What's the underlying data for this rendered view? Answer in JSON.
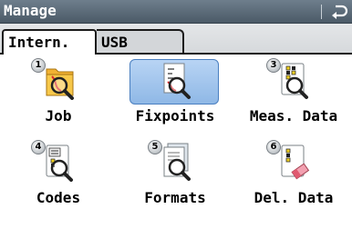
{
  "window": {
    "title": "Manage"
  },
  "tabs": [
    {
      "label": "Intern.",
      "active": true
    },
    {
      "label": "USB",
      "active": false
    }
  ],
  "items": [
    {
      "label": "Job",
      "badge": "1",
      "icon": "folder-search-icon",
      "selected": false
    },
    {
      "label": "Fixpoints",
      "badge": "",
      "icon": "fixpoints-search-icon",
      "selected": true
    },
    {
      "label": "Meas. Data",
      "badge": "3",
      "icon": "measurement-data-search-icon",
      "selected": false
    },
    {
      "label": "Codes",
      "badge": "4",
      "icon": "codes-search-icon",
      "selected": false
    },
    {
      "label": "Formats",
      "badge": "5",
      "icon": "formats-search-icon",
      "selected": false
    },
    {
      "label": "Del. Data",
      "badge": "6",
      "icon": "delete-data-icon",
      "selected": false
    }
  ],
  "colors": {
    "titlebar": "#4b5a67",
    "selection": "#8fb8e6"
  }
}
